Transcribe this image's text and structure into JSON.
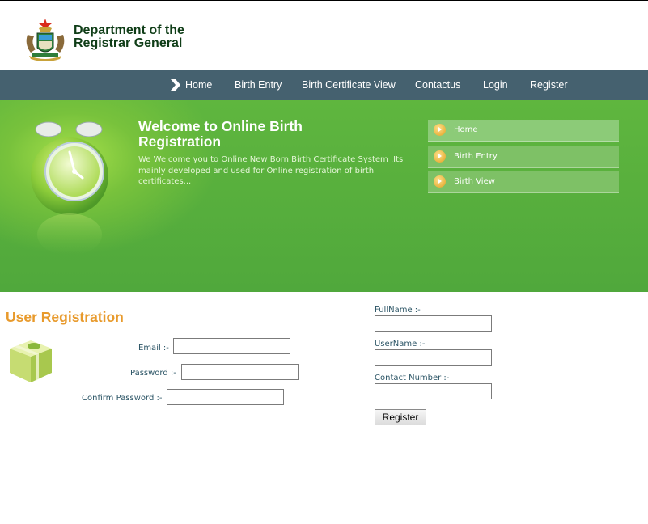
{
  "header": {
    "department_title": "Department of the Registrar General",
    "crest_icon": "coat-of-arms-icon"
  },
  "nav": {
    "items": [
      {
        "label": "Home",
        "icon": "chevron-right-icon"
      },
      {
        "label": "Birth Entry"
      },
      {
        "label": "Birth Certificate View"
      },
      {
        "label": "Contactus"
      },
      {
        "label": "Login"
      },
      {
        "label": "Register"
      }
    ]
  },
  "banner": {
    "title": "Welcome to Online Birth Registration",
    "text": "We Welcome you to Online New Born Birth Certificate System .Its mainly developed and used for Online registration of birth certificates...",
    "image_icon": "alarm-clock-icon",
    "side_menu": [
      {
        "label": "Home"
      },
      {
        "label": "Birth Entry"
      },
      {
        "label": "Birth View"
      }
    ]
  },
  "form": {
    "heading": "User Registration",
    "icon": "gift-box-icon",
    "email_label": "Email :-",
    "email_value": "",
    "password_label": "Password :-",
    "password_value": "",
    "confirm_password_label": "Confirm Password :-",
    "confirm_password_value": "",
    "fullname_label": "FullName :-",
    "fullname_value": "",
    "username_label": "UserName :-",
    "username_value": "",
    "contact_label": "Contact Number :-",
    "contact_value": "",
    "register_button": "Register"
  },
  "colors": {
    "nav_bg": "#45616f",
    "banner_green": "#5fb63e",
    "heading_orange": "#e89a2c",
    "label_text": "#2c5566"
  }
}
